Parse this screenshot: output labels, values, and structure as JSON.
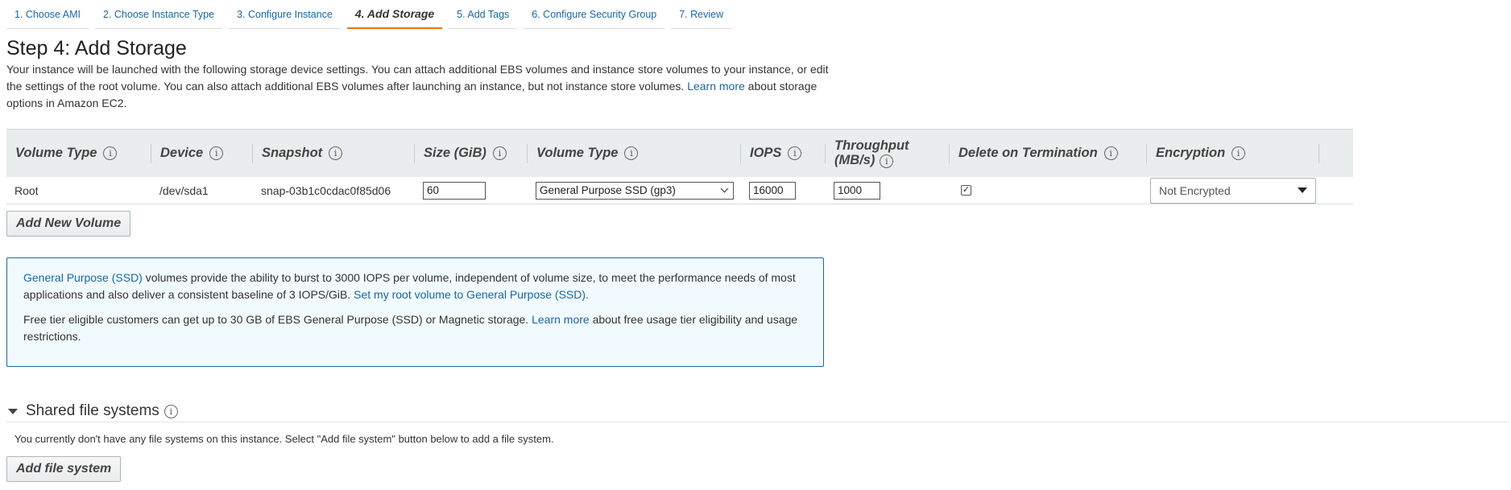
{
  "wizard": {
    "tabs": [
      {
        "label": "1. Choose AMI"
      },
      {
        "label": "2. Choose Instance Type"
      },
      {
        "label": "3. Configure Instance"
      },
      {
        "label": "4. Add Storage"
      },
      {
        "label": "5. Add Tags"
      },
      {
        "label": "6. Configure Security Group"
      },
      {
        "label": "7. Review"
      }
    ],
    "active_index": 3
  },
  "page": {
    "title": "Step 4: Add Storage",
    "intro_text_1": "Your instance will be launched with the following storage device settings. You can attach additional EBS volumes and instance store volumes to your instance, or edit the settings of the root volume. You can also attach additional EBS volumes after launching an instance, but not instance store volumes.",
    "intro_link": "Learn more",
    "intro_text_2": "about storage options in Amazon EC2."
  },
  "table": {
    "headers": {
      "volume_type": "Volume Type",
      "device": "Device",
      "snapshot": "Snapshot",
      "size": "Size (GiB)",
      "volume_type_2": "Volume Type",
      "iops": "IOPS",
      "throughput": "Throughput (MB/s)",
      "delete_on_termination": "Delete on Termination",
      "encryption": "Encryption"
    },
    "row": {
      "volume_type": "Root",
      "device": "/dev/sda1",
      "snapshot": "snap-03b1c0cdac0f85d06",
      "size": "60",
      "volume_type_select": "General Purpose SSD (gp3)",
      "iops": "16000",
      "throughput": "1000",
      "delete_on_termination": true,
      "encryption": "Not Encrypted"
    }
  },
  "add_volume_button": "Add New Volume",
  "info_box": {
    "link_1": "General Purpose (SSD)",
    "text_1": "volumes provide the ability to burst to 3000 IOPS per volume, independent of volume size, to meet the performance needs of most applications and also deliver a consistent baseline of 3 IOPS/GiB.",
    "link_2": "Set my root volume to General Purpose (SSD).",
    "text_2": "Free tier eligible customers can get up to 30 GB of EBS General Purpose (SSD) or Magnetic storage.",
    "link_3": "Learn more",
    "text_3": "about free usage tier eligibility and usage restrictions."
  },
  "shared_fs": {
    "title": "Shared file systems",
    "note": "You currently don't have any file systems on this instance. Select \"Add file system\" button below to add a file system.",
    "button": "Add file system"
  },
  "colors": {
    "link": "#1a66a8",
    "active_tab_accent": "#ec7211",
    "table_header_bg": "#eaeded",
    "info_box_bg": "#f1faff",
    "info_box_border": "#1a66a8"
  }
}
